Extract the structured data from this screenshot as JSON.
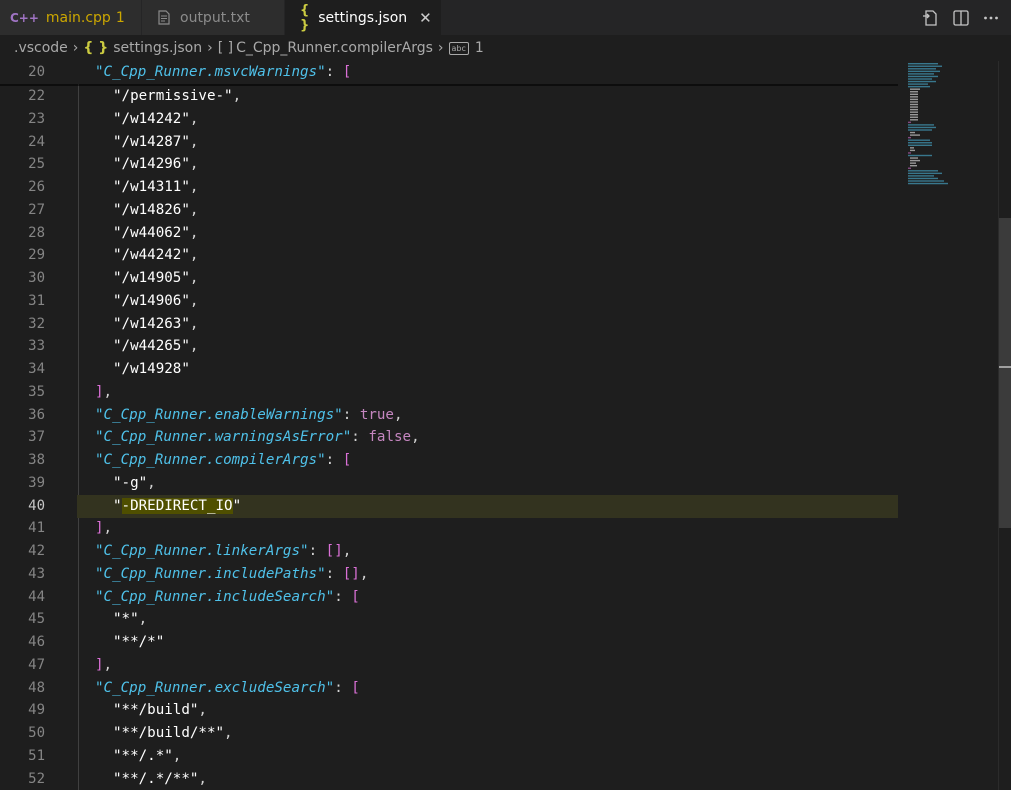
{
  "tabs": [
    {
      "icon": "C++",
      "label": "main.cpp",
      "badge": "1"
    },
    {
      "icon": "",
      "label": "output.txt"
    },
    {
      "icon": "{ }",
      "label": "settings.json",
      "close": "✕"
    }
  ],
  "breadcrumb": {
    "folder": ".vscode",
    "file_icon": "{ }",
    "file": "settings.json",
    "array_icon": "[ ]",
    "key": "C_Cpp_Runner.compilerArgs",
    "item_icon": "abc",
    "item": "1"
  },
  "editor": {
    "sticky_line": {
      "number": "20",
      "key": "C_Cpp_Runner.msvcWarnings",
      "suffix": ": ",
      "bracket": "["
    },
    "lines": [
      {
        "n": "22",
        "t": "\"/permissive-\","
      },
      {
        "n": "23",
        "t": "\"/w14242\","
      },
      {
        "n": "24",
        "t": "\"/w14287\","
      },
      {
        "n": "25",
        "t": "\"/w14296\","
      },
      {
        "n": "26",
        "t": "\"/w14311\","
      },
      {
        "n": "27",
        "t": "\"/w14826\","
      },
      {
        "n": "28",
        "t": "\"/w44062\","
      },
      {
        "n": "29",
        "t": "\"/w44242\","
      },
      {
        "n": "30",
        "t": "\"/w14905\","
      },
      {
        "n": "31",
        "t": "\"/w14906\","
      },
      {
        "n": "32",
        "t": "\"/w14263\","
      },
      {
        "n": "33",
        "t": "\"/w44265\","
      },
      {
        "n": "34",
        "t": "\"/w14928\""
      },
      {
        "n": "35",
        "t": "],"
      },
      {
        "n": "36",
        "key": "C_Cpp_Runner.enableWarnings",
        "val": "true,"
      },
      {
        "n": "37",
        "key": "C_Cpp_Runner.warningsAsError",
        "val": "false,"
      },
      {
        "n": "38",
        "key": "C_Cpp_Runner.compilerArgs",
        "val": "["
      },
      {
        "n": "39",
        "t": "\"-g\","
      },
      {
        "n": "40",
        "t": "\"-DREDIRECT_IO\""
      },
      {
        "n": "41",
        "t": "],"
      },
      {
        "n": "42",
        "key": "C_Cpp_Runner.linkerArgs",
        "val": "[],"
      },
      {
        "n": "43",
        "key": "C_Cpp_Runner.includePaths",
        "val": "[],"
      },
      {
        "n": "44",
        "key": "C_Cpp_Runner.includeSearch",
        "val": "["
      },
      {
        "n": "45",
        "t": "\"*\","
      },
      {
        "n": "46",
        "t": "\"**/*\""
      },
      {
        "n": "47",
        "t": "],"
      },
      {
        "n": "48",
        "key": "C_Cpp_Runner.excludeSearch",
        "val": "["
      },
      {
        "n": "49",
        "t": "\"**/build\","
      },
      {
        "n": "50",
        "t": "\"**/build/**\","
      },
      {
        "n": "51",
        "t": "\"**/.*\","
      },
      {
        "n": "52",
        "t": "\"**/.*/**\","
      }
    ],
    "current_line": "40"
  },
  "colors": {
    "background": "#1e1e1e",
    "key": "#4fc1e9",
    "string": "#ffffff",
    "bracket": "#da70d6",
    "keyword": "#c586c0",
    "line_number": "#858585",
    "tab_warning": "#cca700"
  },
  "icons": {
    "tab_main": "cpp-file-icon",
    "tab_output": "text-file-icon",
    "tab_settings": "json-file-icon",
    "actions": [
      "open-changes-icon",
      "split-editor-icon",
      "more-actions-icon"
    ]
  }
}
